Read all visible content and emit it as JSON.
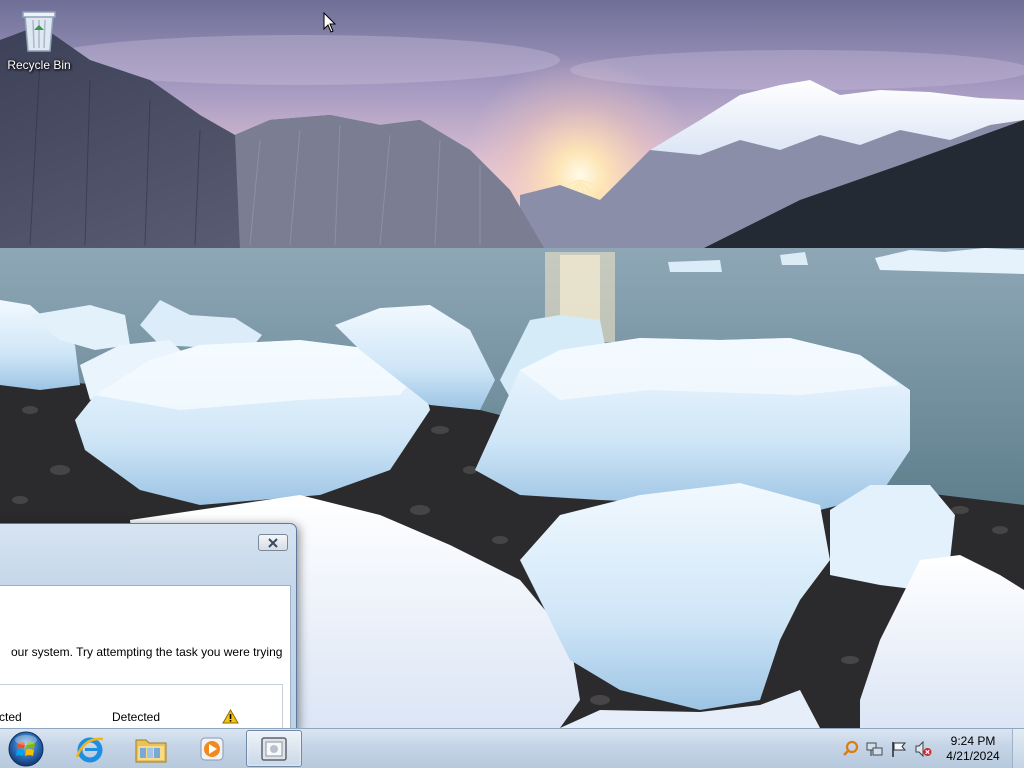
{
  "desktop": {
    "icons": [
      {
        "label": "Recycle Bin",
        "icon": "recycle-bin-icon"
      }
    ]
  },
  "dialog": {
    "close_icon": "close-icon",
    "message": "our system. Try attempting the task you were trying",
    "row": {
      "col1": "tected",
      "col2": "Detected",
      "status_icon": "warning-icon"
    }
  },
  "taskbar": {
    "start_icon": "windows-start-icon",
    "pinned": [
      {
        "icon": "internet-explorer-icon"
      },
      {
        "icon": "file-explorer-icon"
      },
      {
        "icon": "media-player-icon"
      },
      {
        "icon": "app-window-icon",
        "active": true
      }
    ],
    "tray_icons": [
      "search-icon",
      "network-icon",
      "action-center-flag-icon",
      "volume-muted-icon"
    ],
    "clock": {
      "time": "9:24 PM",
      "date": "4/21/2024"
    }
  },
  "colors": {
    "taskbar_top": "#dbe6f2",
    "taskbar_bottom": "#b7c9de",
    "warning_yellow": "#f4c20d"
  }
}
